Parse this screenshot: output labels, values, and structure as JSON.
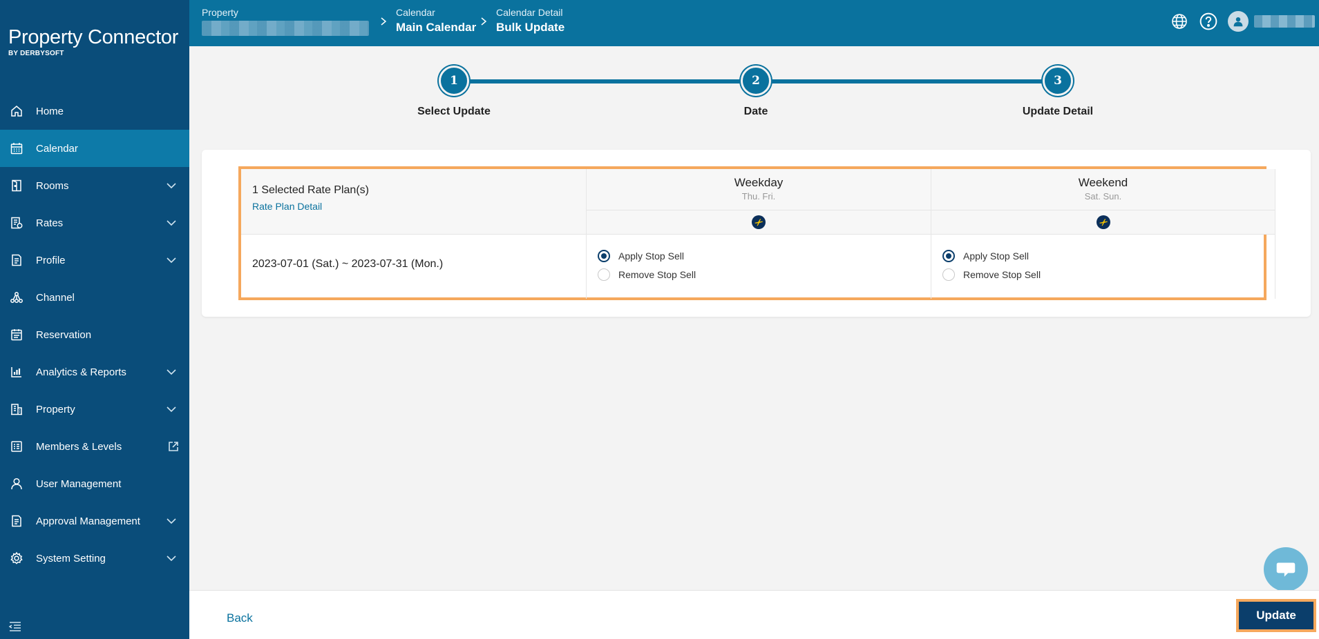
{
  "brand": {
    "name": "Property Connector",
    "sub": "BY DERBYSOFT"
  },
  "sidebar": {
    "items": [
      {
        "label": "Home",
        "icon": "home-icon",
        "chevron": false,
        "active": false
      },
      {
        "label": "Calendar",
        "icon": "calendar-icon",
        "chevron": false,
        "active": true
      },
      {
        "label": "Rooms",
        "icon": "door-icon",
        "chevron": true,
        "active": false
      },
      {
        "label": "Rates",
        "icon": "rates-icon",
        "chevron": true,
        "active": false
      },
      {
        "label": "Profile",
        "icon": "document-icon",
        "chevron": true,
        "active": false
      },
      {
        "label": "Channel",
        "icon": "network-icon",
        "chevron": false,
        "active": false
      },
      {
        "label": "Reservation",
        "icon": "reservation-icon",
        "chevron": false,
        "active": false
      },
      {
        "label": "Analytics & Reports",
        "icon": "chart-icon",
        "chevron": true,
        "active": false
      },
      {
        "label": "Property",
        "icon": "building-icon",
        "chevron": true,
        "active": false
      },
      {
        "label": "Members & Levels",
        "icon": "list-icon",
        "chevron": false,
        "external": true,
        "active": false
      },
      {
        "label": "User Management",
        "icon": "user-icon",
        "chevron": false,
        "active": false
      },
      {
        "label": "Approval Management",
        "icon": "approval-icon",
        "chevron": true,
        "active": false
      },
      {
        "label": "System Setting",
        "icon": "gear-icon",
        "chevron": true,
        "active": false
      }
    ]
  },
  "header": {
    "crumbs": [
      {
        "small": "Property",
        "big": ""
      },
      {
        "small": "Calendar",
        "big": "Main Calendar"
      },
      {
        "small": "Calendar Detail",
        "big": "Bulk Update"
      }
    ]
  },
  "stepper": {
    "steps": [
      {
        "number": "1",
        "label": "Select Update"
      },
      {
        "number": "2",
        "label": "Date"
      },
      {
        "number": "3",
        "label": "Update Detail"
      }
    ]
  },
  "table": {
    "rate_plan_title": "1 Selected Rate Plan(s)",
    "rate_plan_link": "Rate Plan Detail",
    "date_range": "2023-07-01 (Sat.) ~ 2023-07-31 (Mon.)",
    "columns": [
      {
        "title": "Weekday",
        "sub": "Thu. Fri.",
        "apply_label": "Apply Stop Sell",
        "remove_label": "Remove Stop Sell",
        "selected": "apply"
      },
      {
        "title": "Weekend",
        "sub": "Sat. Sun.",
        "apply_label": "Apply Stop Sell",
        "remove_label": "Remove Stop Sell",
        "selected": "apply"
      }
    ]
  },
  "footer": {
    "back_label": "Back",
    "update_label": "Update"
  },
  "colors": {
    "sidebar": "#0a4d7a",
    "topbar": "#0a729e",
    "active": "#0d7aa8",
    "highlight": "#f5a85d",
    "primary_button": "#0b3e6b"
  }
}
